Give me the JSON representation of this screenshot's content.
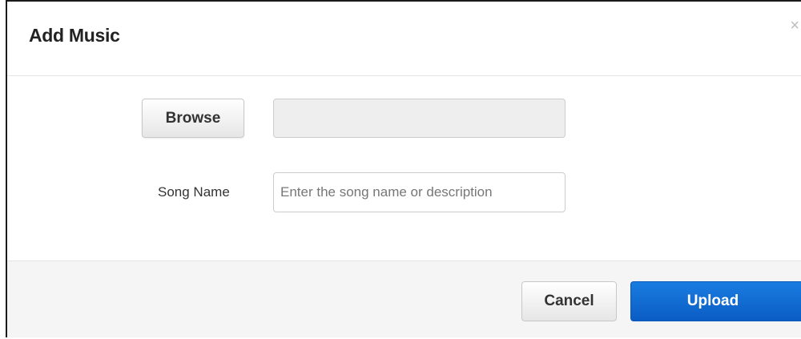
{
  "dialog": {
    "title": "Add Music",
    "close_glyph": "×"
  },
  "form": {
    "browse_label": "Browse",
    "file_value": "",
    "song_name_label": "Song Name",
    "song_name_value": "",
    "song_name_placeholder": "Enter the song name or description"
  },
  "footer": {
    "cancel_label": "Cancel",
    "upload_label": "Upload"
  },
  "colors": {
    "primary": "#0a5cc4",
    "footer_bg": "#f5f5f5",
    "field_disabled_bg": "#eeeeee"
  },
  "icons": {
    "close": "close-icon"
  }
}
